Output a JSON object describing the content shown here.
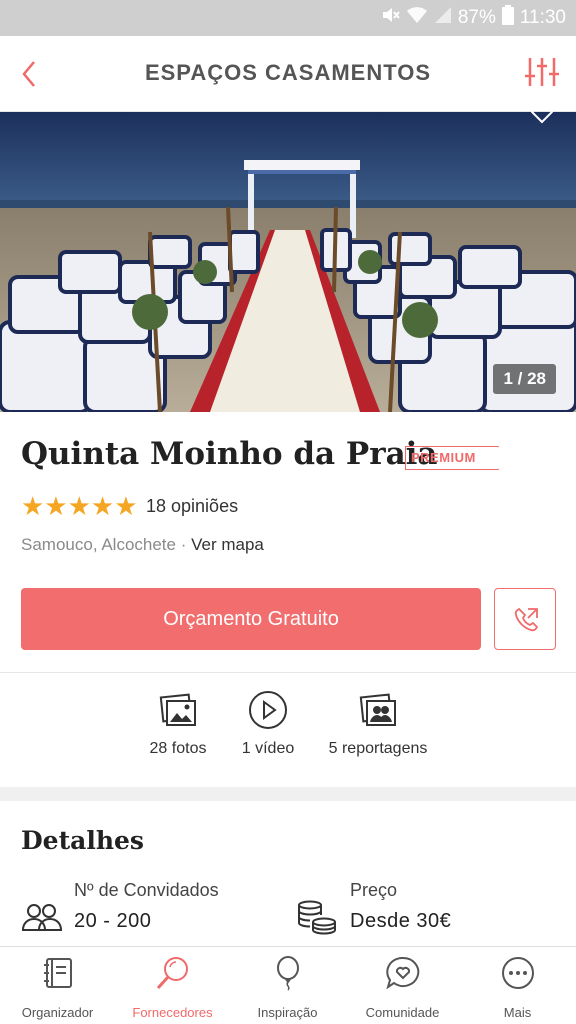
{
  "status_bar": {
    "battery": "87%",
    "time": "11:30"
  },
  "header": {
    "title": "ESPAÇOS CASAMENTOS",
    "back_icon": "chevron-left-icon",
    "filter_icon": "sliders-icon"
  },
  "gallery": {
    "counter": "1 / 28"
  },
  "venue": {
    "name": "Quinta Moinho da Praia",
    "badge": "PREMIUM",
    "rating": 5,
    "stars": "★★★★★",
    "reviews": "18 opiniões",
    "location": "Samouco, Alcochete",
    "separator": " · ",
    "map_link": "Ver mapa"
  },
  "actions": {
    "quote_label": "Orçamento Gratuito",
    "call_icon": "phone-icon"
  },
  "media": [
    {
      "label": "28 fotos",
      "icon": "photos-icon"
    },
    {
      "label": "1 vídeo",
      "icon": "play-icon"
    },
    {
      "label": "5 reportagens",
      "icon": "albums-icon"
    }
  ],
  "details": {
    "title": "Detalhes",
    "guests": {
      "label": "Nº de Convidados",
      "value": "20 - 200",
      "icon": "people-icon"
    },
    "price": {
      "label": "Preço",
      "value": "Desde 30€",
      "icon": "coins-icon"
    }
  },
  "bottom_nav": [
    {
      "label": "Organizador",
      "icon": "notebook-icon",
      "active": false
    },
    {
      "label": "Fornecedores",
      "icon": "search-icon",
      "active": true
    },
    {
      "label": "Inspiração",
      "icon": "balloon-icon",
      "active": false
    },
    {
      "label": "Comunidade",
      "icon": "chat-heart-icon",
      "active": false
    },
    {
      "label": "Mais",
      "icon": "more-icon",
      "active": false
    }
  ],
  "colors": {
    "accent": "#f26d6d",
    "star": "#f5a623"
  }
}
